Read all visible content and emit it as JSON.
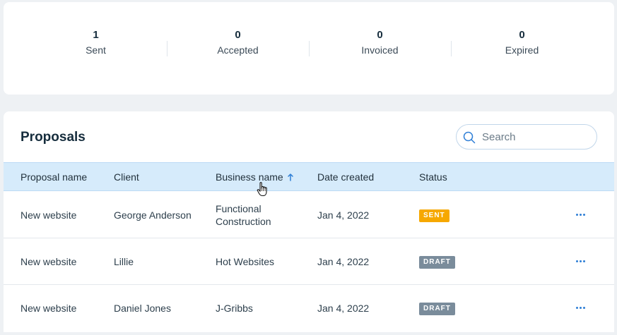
{
  "stats": [
    {
      "value": "1",
      "label": "Sent"
    },
    {
      "value": "0",
      "label": "Accepted"
    },
    {
      "value": "0",
      "label": "Invoiced"
    },
    {
      "value": "0",
      "label": "Expired"
    }
  ],
  "proposals": {
    "title": "Proposals",
    "search": {
      "placeholder": "Search",
      "value": ""
    },
    "columns": [
      "Proposal name",
      "Client",
      "Business name",
      "Date created",
      "Status"
    ],
    "sort_column": "Business name",
    "sort_direction": "ascending",
    "rows": [
      {
        "proposal_name": "New website",
        "client": "George Anderson",
        "business_line1": "Functional",
        "business_line2": "Construction",
        "date": "Jan 4, 2022",
        "status": "SENT"
      },
      {
        "proposal_name": "New website",
        "client": "Lillie",
        "business_line1": "Hot Websites",
        "business_line2": "",
        "date": "Jan 4, 2022",
        "status": "DRAFT"
      },
      {
        "proposal_name": "New website",
        "client": "Daniel Jones",
        "business_line1": "J-Gribbs",
        "business_line2": "",
        "date": "Jan 4, 2022",
        "status": "DRAFT"
      }
    ]
  },
  "colors": {
    "accent": "#2f7fd6",
    "header_bg": "#d6ebfb",
    "status_sent": "#f6a800",
    "status_draft": "#7a8c9b",
    "page_bg": "#eef1f4"
  },
  "icons": {
    "search": "search-icon",
    "sort": "arrow-up-icon",
    "more": "more-actions-icon",
    "cursor": "hand-pointer-cursor"
  }
}
